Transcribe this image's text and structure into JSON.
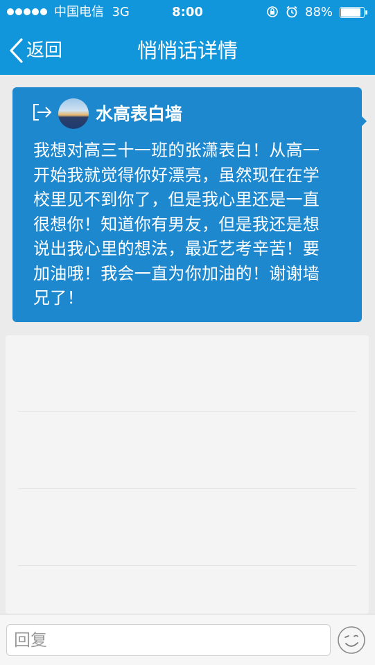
{
  "status_bar": {
    "carrier": "中国电信",
    "network": "3G",
    "time": "8:00",
    "battery_percent": "88%",
    "battery_level": 0.88,
    "icons": [
      "signal-dots",
      "rotation-lock-icon",
      "alarm-icon",
      "battery-icon"
    ]
  },
  "nav": {
    "back_label": "返回",
    "title": "悄悄话详情"
  },
  "post": {
    "author": "水高表白墙",
    "text": "我想对高三十一班的张潇表白！从高一开始我就觉得你好漂亮，虽然现在在学校里见不到你了，但是我心里还是一直很想你！知道你有男友，但是我还是想说出我心里的想法，最近艺考辛苦！要加油哦！我会一直为你加油的！谢谢墙兄了！"
  },
  "reply": {
    "placeholder": "回复",
    "value": ""
  },
  "colors": {
    "header_blue": "#1296db",
    "card_blue": "#1e88cf",
    "background": "#ebebeb"
  }
}
